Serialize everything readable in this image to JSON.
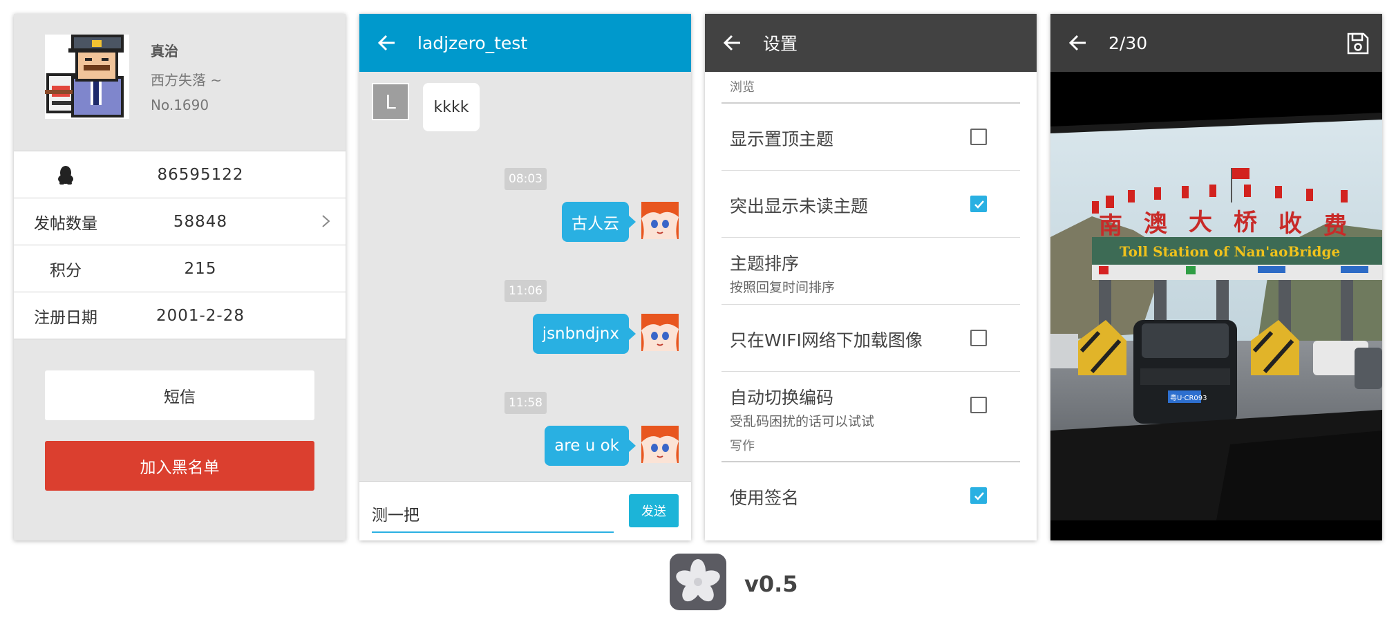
{
  "profile": {
    "name": "真治",
    "signature": "西方失落 ~",
    "number": "No.1690",
    "rows": [
      {
        "icon": "qq-penguin-icon",
        "label": "",
        "value": "86595122"
      },
      {
        "label": "发帖数量",
        "value": "58848"
      },
      {
        "label": "积分",
        "value": "215"
      },
      {
        "label": "注册日期",
        "value": "2001-2-28"
      }
    ],
    "sms_label": "短信",
    "blacklist_label": "加入黑名单",
    "colors": {
      "danger": "#db3f2f"
    }
  },
  "chat": {
    "title": "ladjzero_test",
    "incoming": {
      "avatar_letter": "L",
      "text": "kkkk"
    },
    "messages": [
      {
        "time": "08:03",
        "text": "古人云"
      },
      {
        "time": "11:06",
        "text": "jsnbndjnx"
      },
      {
        "time": "11:58",
        "text": "are u ok"
      }
    ],
    "input_value": "测一把",
    "send_label": "发送",
    "colors": {
      "appbar": "#0099cc",
      "bubble": "#29b0e2"
    }
  },
  "settings": {
    "title": "设置",
    "categories": {
      "browse": "浏览",
      "write": "写作"
    },
    "items": [
      {
        "title": "显示置顶主题",
        "checked": false
      },
      {
        "title": "突出显示未读主题",
        "checked": true
      },
      {
        "title": "主题排序",
        "subtitle": "按照回复时间排序"
      },
      {
        "title": "只在WIFI网络下加载图像",
        "checked": false
      },
      {
        "title": "自动切换编码",
        "subtitle": "受乱码困扰的话可以试试",
        "checked": false
      },
      {
        "title": "使用签名",
        "checked": true
      }
    ]
  },
  "viewer": {
    "counter": "2/30",
    "photo_sign_text": "Toll Station of Nan'aoBridge",
    "plate": "粤U·CR093"
  },
  "brand": {
    "version": "v0.5"
  }
}
